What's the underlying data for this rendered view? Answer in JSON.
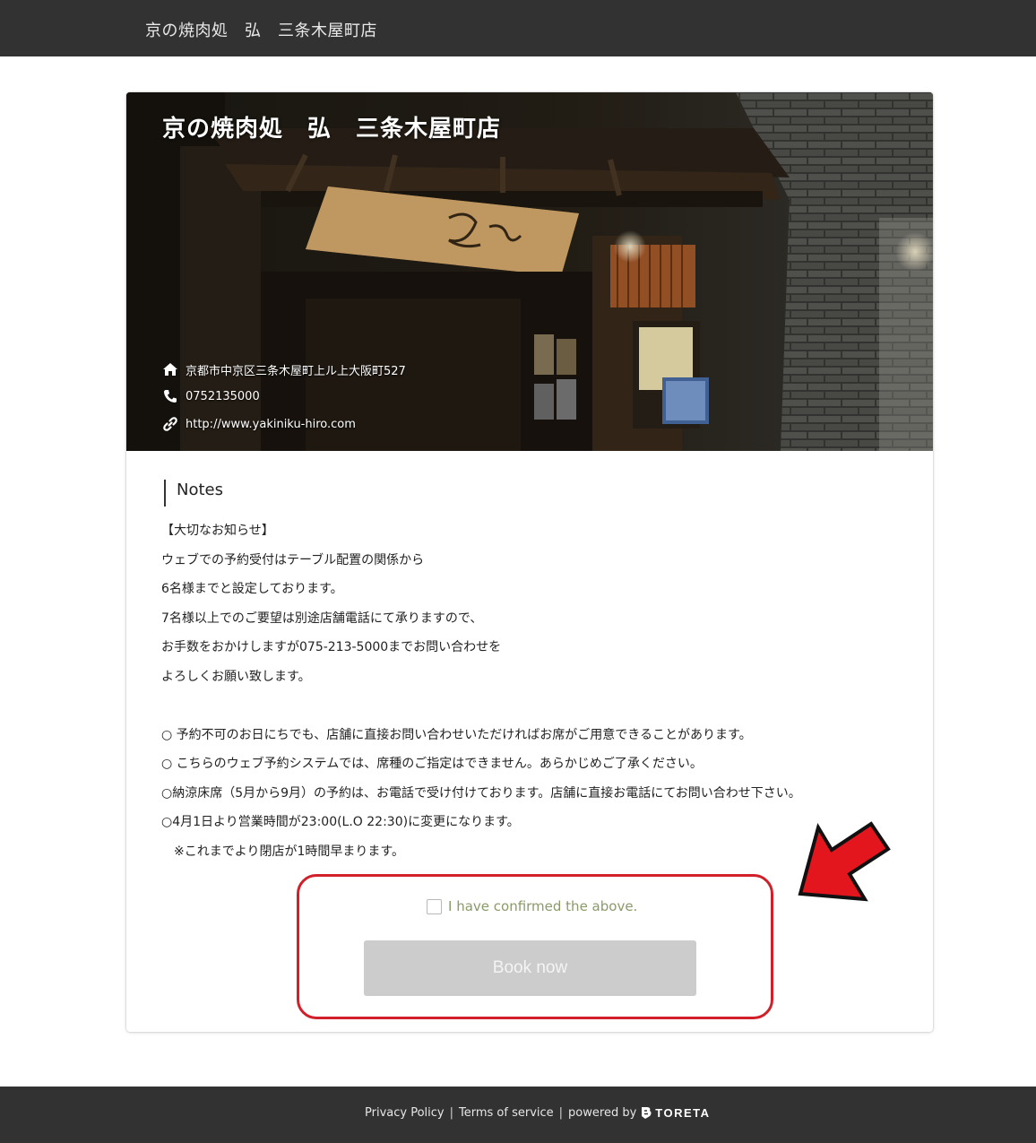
{
  "header": {
    "title": "京の焼肉処　弘　三条木屋町店"
  },
  "restaurant": {
    "name": "京の焼肉処　弘　三条木屋町店",
    "address": "京都市中京区三条木屋町上ル上大阪町527",
    "phone": "0752135000",
    "website": "http://www.yakiniku-hiro.com"
  },
  "notes": {
    "heading": "Notes",
    "lines": [
      "【大切なお知らせ】",
      "ウェブでの予約受付はテーブル配置の関係から",
      "6名様までと設定しております。",
      "7名様以上でのご要望は別途店舗電話にて承りますので、",
      "お手数をおかけしますが075-213-5000までお問い合わせを",
      "よろしくお願い致します。",
      "",
      "○ 予約不可のお日にちでも、店舗に直接お問い合わせいただければお席がご用意できることがあります。",
      "○ こちらのウェブ予約システムでは、席種のご指定はできません。あらかじめご了承ください。",
      "○納涼床席（5月から9月）の予約は、お電話で受け付けております。店舗に直接お電話にてお問い合わせ下さい。",
      "○4月1日より営業時間が23:00(L.O 22:30)に変更になります。",
      "　※これまでより閉店が1時間早まります。"
    ]
  },
  "confirm": {
    "label": "I have confirmed the above.",
    "checked": false
  },
  "booking": {
    "button_label": "Book now",
    "enabled": false
  },
  "footer": {
    "privacy": "Privacy Policy",
    "terms": "Terms of service",
    "powered_by": "powered by",
    "brand": "TORETA"
  },
  "colors": {
    "header_bg": "#323232",
    "highlight_border": "#d1202a",
    "arrow": "#e3161d",
    "button_disabled": "#cccccc"
  },
  "icons": [
    "home-icon",
    "phone-icon",
    "link-icon",
    "checkbox-icon",
    "arrow-annotation-icon",
    "toreta-logo-icon"
  ]
}
